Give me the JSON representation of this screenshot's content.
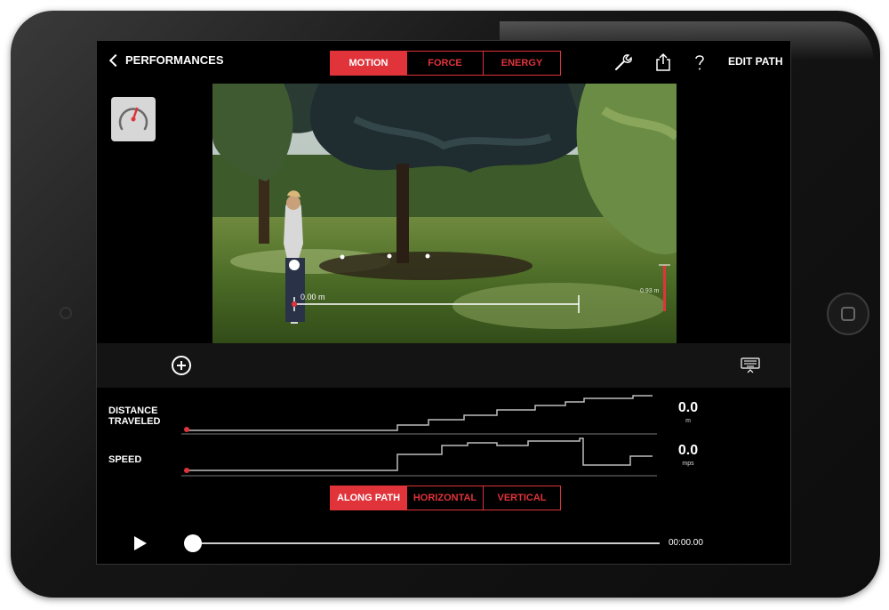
{
  "header": {
    "back_label": "PERFORMANCES",
    "tabs": [
      {
        "label": "MOTION",
        "active": true
      },
      {
        "label": "FORCE",
        "active": false
      },
      {
        "label": "ENERGY",
        "active": false
      }
    ],
    "tools_icon": "wrench-icon",
    "share_icon": "share-icon",
    "help_icon": "help-icon",
    "edit_label": "EDIT PATH"
  },
  "video": {
    "measure_label": "0.00 m",
    "height_label": "0.93 m"
  },
  "graphs": {
    "distance": {
      "label_line1": "DISTANCE",
      "label_line2": "TRAVELED",
      "value": "0.0",
      "unit": "m"
    },
    "speed": {
      "label": "SPEED",
      "value": "0.0",
      "unit": "mps"
    }
  },
  "direction_tabs": [
    {
      "label": "ALONG PATH",
      "active": true
    },
    {
      "label": "HORIZONTAL",
      "active": false
    },
    {
      "label": "VERTICAL",
      "active": false
    }
  ],
  "playback": {
    "time": "00:00.00",
    "progress": 0
  },
  "colors": {
    "accent": "#e0333a",
    "background": "#000000"
  }
}
